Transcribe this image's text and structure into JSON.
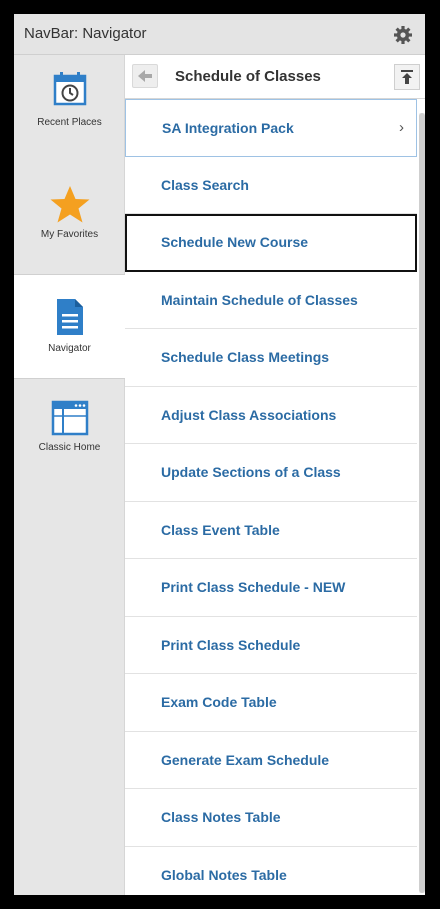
{
  "header": {
    "title": "NavBar: Navigator",
    "settings_icon": "gear-icon"
  },
  "rail": {
    "items": [
      {
        "label": "Recent Places",
        "icon": "calendar-clock-icon",
        "active": false
      },
      {
        "label": "My Favorites",
        "icon": "star-icon",
        "active": false
      },
      {
        "label": "Navigator",
        "icon": "document-icon",
        "active": true
      },
      {
        "label": "Classic Home",
        "icon": "window-icon",
        "active": false
      }
    ]
  },
  "panel": {
    "title": "Schedule of Classes",
    "back_icon": "back-arrow-icon",
    "top_icon": "collapse-top-icon",
    "items": [
      {
        "label": "SA Integration Pack",
        "has_children": true
      },
      {
        "label": "Class Search"
      },
      {
        "label": "Schedule New Course",
        "highlighted": true
      },
      {
        "label": "Maintain Schedule of Classes"
      },
      {
        "label": "Schedule Class Meetings"
      },
      {
        "label": "Adjust Class Associations"
      },
      {
        "label": "Update Sections of a Class"
      },
      {
        "label": "Class Event Table"
      },
      {
        "label": "Print Class Schedule - NEW"
      },
      {
        "label": "Print Class Schedule"
      },
      {
        "label": "Exam Code Table"
      },
      {
        "label": "Generate Exam Schedule"
      },
      {
        "label": "Class Notes Table"
      },
      {
        "label": "Global Notes Table"
      }
    ]
  },
  "colors": {
    "link": "#2b6ba4",
    "accent_star": "#f4a020",
    "accent_icon": "#3a86d0"
  }
}
